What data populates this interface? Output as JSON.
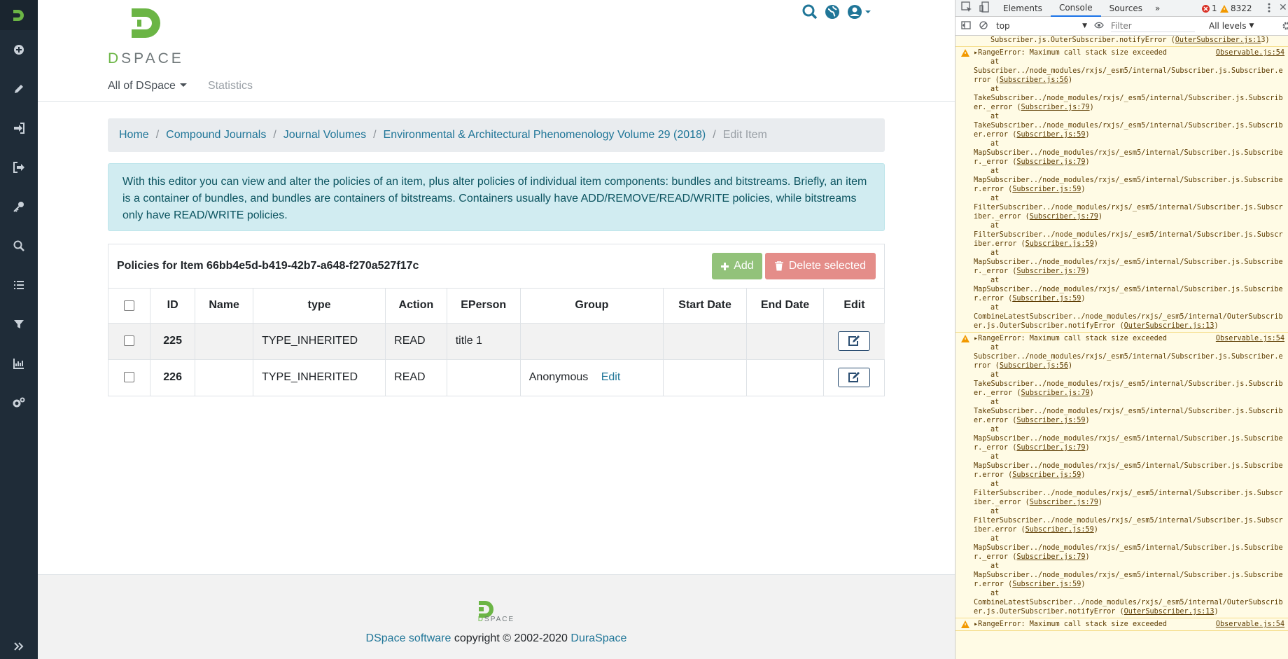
{
  "app": {
    "brand": "DSPACE",
    "nav": {
      "all_of": "All of DSpace",
      "statistics": "Statistics"
    }
  },
  "breadcrumb": {
    "items": [
      "Home",
      "Compound Journals",
      "Journal Volumes",
      "Environmental & Architectural Phenomenology Volume 29 (2018)"
    ],
    "active": "Edit Item"
  },
  "alert": {
    "text": "With this editor you can view and alter the policies of an item, plus alter policies of individual item components: bundles and bitstreams. Briefly, an item is a container of bundles, and bundles are containers of bitstreams. Containers usually have ADD/REMOVE/READ/WRITE policies, while bitstreams only have READ/WRITE policies."
  },
  "policies": {
    "title": "Policies for Item 66bb4e5d-b419-42b7-a648-f270a527f17c",
    "add_label": "Add",
    "delete_label": "Delete selected",
    "columns": [
      "ID",
      "Name",
      "type",
      "Action",
      "EPerson",
      "Group",
      "Start Date",
      "End Date",
      "Edit"
    ],
    "rows": [
      {
        "id": "225",
        "name": "",
        "type": "TYPE_INHERITED",
        "action": "READ",
        "eperson": "title 1",
        "group": "",
        "group_edit": "",
        "start": "",
        "end": ""
      },
      {
        "id": "226",
        "name": "",
        "type": "TYPE_INHERITED",
        "action": "READ",
        "eperson": "",
        "group": "Anonymous",
        "group_edit": "Edit",
        "start": "",
        "end": ""
      }
    ]
  },
  "footer": {
    "brand": "DSPACE",
    "software_link": "DSpace software",
    "copyright": " copyright © 2002-2020 ",
    "duraspace_link": "DuraSpace"
  },
  "devtools": {
    "tabs": [
      "Elements",
      "Console",
      "Sources"
    ],
    "active_tab": "Console",
    "error_count": "1",
    "warning_count": "8322",
    "context": "top",
    "filter_placeholder": "Filter",
    "levels": "All levels",
    "preface": [
      "Subscriber.js.OuterSubscriber.notifyError (",
      "OuterSubscriber.js:1",
      "3)"
    ],
    "messages": [
      {
        "text": "RangeError: Maximum call stack size exceeded",
        "source": "Observable.js:54",
        "frames": [
          [
            "Subscriber../node_modules/rxjs/_esm5/internal/Subscriber.js.Subscriber.error (",
            "Subscriber.js:56",
            ")"
          ],
          [
            "TakeSubscriber../node_modules/rxjs/_esm5/internal/Subscriber.js.Subscriber._error (",
            "Subscriber.js:79",
            ")"
          ],
          [
            "TakeSubscriber../node_modules/rxjs/_esm5/internal/Subscriber.js.Subscriber.error (",
            "Subscriber.js:59",
            ")"
          ],
          [
            "MapSubscriber../node_modules/rxjs/_esm5/internal/Subscriber.js.Subscriber._error (",
            "Subscriber.js:79",
            ")"
          ],
          [
            "MapSubscriber../node_modules/rxjs/_esm5/internal/Subscriber.js.Subscriber.error (",
            "Subscriber.js:59",
            ")"
          ],
          [
            "FilterSubscriber../node_modules/rxjs/_esm5/internal/Subscriber.js.Subscriber._error (",
            "Subscriber.js:79",
            ")"
          ],
          [
            "FilterSubscriber../node_modules/rxjs/_esm5/internal/Subscriber.js.Subscriber.error (",
            "Subscriber.js:59",
            ")"
          ],
          [
            "MapSubscriber../node_modules/rxjs/_esm5/internal/Subscriber.js.Subscriber._error (",
            "Subscriber.js:79",
            ")"
          ],
          [
            "MapSubscriber../node_modules/rxjs/_esm5/internal/Subscriber.js.Subscriber.error (",
            "Subscriber.js:59",
            ")"
          ],
          [
            "CombineLatestSubscriber../node_modules/rxjs/_esm5/internal/OuterSubscriber.js.OuterSubscriber.notifyError (",
            "OuterSubscriber.js:13",
            ")"
          ]
        ]
      },
      {
        "text": "RangeError: Maximum call stack size exceeded",
        "source": "Observable.js:54",
        "frames": [
          [
            "Subscriber../node_modules/rxjs/_esm5/internal/Subscriber.js.Subscriber.error (",
            "Subscriber.js:56",
            ")"
          ],
          [
            "TakeSubscriber../node_modules/rxjs/_esm5/internal/Subscriber.js.Subscriber._error (",
            "Subscriber.js:79",
            ")"
          ],
          [
            "TakeSubscriber../node_modules/rxjs/_esm5/internal/Subscriber.js.Subscriber.error (",
            "Subscriber.js:59",
            ")"
          ],
          [
            "MapSubscriber../node_modules/rxjs/_esm5/internal/Subscriber.js.Subscriber._error (",
            "Subscriber.js:79",
            ")"
          ],
          [
            "MapSubscriber../node_modules/rxjs/_esm5/internal/Subscriber.js.Subscriber.error (",
            "Subscriber.js:59",
            ")"
          ],
          [
            "FilterSubscriber../node_modules/rxjs/_esm5/internal/Subscriber.js.Subscriber._error (",
            "Subscriber.js:79",
            ")"
          ],
          [
            "FilterSubscriber../node_modules/rxjs/_esm5/internal/Subscriber.js.Subscriber.error (",
            "Subscriber.js:59",
            ")"
          ],
          [
            "MapSubscriber../node_modules/rxjs/_esm5/internal/Subscriber.js.Subscriber._error (",
            "Subscriber.js:79",
            ")"
          ],
          [
            "MapSubscriber../node_modules/rxjs/_esm5/internal/Subscriber.js.Subscriber.error (",
            "Subscriber.js:59",
            ")"
          ],
          [
            "CombineLatestSubscriber../node_modules/rxjs/_esm5/internal/OuterSubscriber.js.OuterSubscriber.notifyError (",
            "OuterSubscriber.js:13",
            ")"
          ]
        ]
      },
      {
        "text": "RangeError: Maximum call stack size exceeded",
        "source": "Observable.js:54",
        "frames": []
      }
    ]
  }
}
